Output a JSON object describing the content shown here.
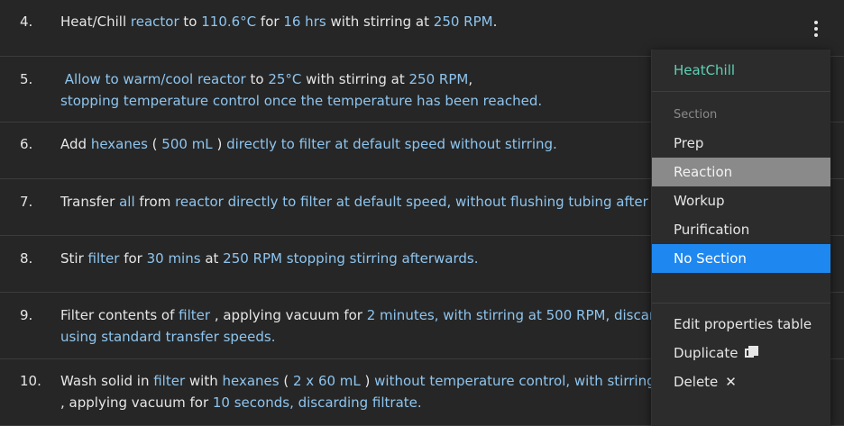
{
  "steps": [
    {
      "num": "4.",
      "lines": [
        [
          [
            "Heat/Chill ",
            "p"
          ],
          [
            "reactor",
            "h"
          ],
          [
            " to ",
            "p"
          ],
          [
            "110.6°C",
            "h"
          ],
          [
            " for ",
            "p"
          ],
          [
            "16 hrs",
            "h"
          ],
          [
            " with stirring at ",
            "p"
          ],
          [
            "250 RPM",
            "h"
          ],
          [
            ".",
            "p"
          ]
        ]
      ]
    },
    {
      "num": "5.",
      "lines": [
        [
          [
            " Allow to warm/cool ",
            "h"
          ],
          [
            "reactor",
            "h"
          ],
          [
            " to ",
            "p"
          ],
          [
            "25°C",
            "h"
          ],
          [
            " with stirring at ",
            "p"
          ],
          [
            "250 RPM",
            "h"
          ],
          [
            ",",
            "p"
          ]
        ],
        [
          [
            "stopping temperature control once the temperature has been reached.",
            "h"
          ]
        ]
      ]
    },
    {
      "num": "6.",
      "lines": [
        [
          [
            "Add ",
            "p"
          ],
          [
            "hexanes",
            "h"
          ],
          [
            " ( ",
            "p"
          ],
          [
            "500 mL",
            "h"
          ],
          [
            " ) ",
            "p"
          ],
          [
            "directly to ",
            "h"
          ],
          [
            "filter",
            "h"
          ],
          [
            " at default speed without stirring.",
            "h"
          ]
        ]
      ]
    },
    {
      "num": "7.",
      "lines": [
        [
          [
            "Transfer ",
            "p"
          ],
          [
            "all",
            "h"
          ],
          [
            " from ",
            "p"
          ],
          [
            "reactor",
            "h"
          ],
          [
            " directly to ",
            "h"
          ],
          [
            "filter",
            "h"
          ],
          [
            " at default speed, without flushing tubing after th",
            "h"
          ]
        ]
      ]
    },
    {
      "num": "8.",
      "lines": [
        [
          [
            "Stir ",
            "p"
          ],
          [
            "filter",
            "h"
          ],
          [
            " for ",
            "p"
          ],
          [
            "30 mins",
            "h"
          ],
          [
            " at ",
            "p"
          ],
          [
            "250 RPM",
            "h"
          ],
          [
            " stopping stirring afterwards.",
            "h"
          ]
        ]
      ]
    },
    {
      "num": "9.",
      "lines": [
        [
          [
            "Filter contents of ",
            "p"
          ],
          [
            "filter",
            "h"
          ],
          [
            " , applying vacuum for ",
            "p"
          ],
          [
            "2 minutes",
            "h"
          ],
          [
            ", with stirring at ",
            "h"
          ],
          [
            "500 RPM",
            "h"
          ],
          [
            ", discardin",
            "h"
          ]
        ],
        [
          [
            "using standard transfer speeds.",
            "h"
          ]
        ]
      ]
    },
    {
      "num": "10.",
      "lines": [
        [
          [
            "Wash solid in ",
            "p"
          ],
          [
            "filter",
            "h"
          ],
          [
            " with ",
            "p"
          ],
          [
            "hexanes",
            "h"
          ],
          [
            " ( ",
            "p"
          ],
          [
            "2 x 60 mL",
            "h"
          ],
          [
            " ) ",
            "p"
          ],
          [
            "without temperature control, with stirring at",
            "h"
          ]
        ],
        [
          [
            ", applying vacuum for ",
            "p"
          ],
          [
            "10 seconds",
            "h"
          ],
          [
            ", discarding filtrate.",
            "h"
          ]
        ]
      ]
    }
  ],
  "menu": {
    "title": "HeatChill",
    "section_header": "Section",
    "sections": [
      "Prep",
      "Reaction",
      "Workup",
      "Purification",
      "No Section"
    ],
    "hovered_section": "Reaction",
    "selected_section": "No Section",
    "actions": {
      "edit": "Edit properties table",
      "duplicate": "Duplicate",
      "delete": "Delete"
    },
    "icons": {
      "duplicate": "copy-icon",
      "delete": "close-icon"
    }
  },
  "colors": {
    "background": "#262626",
    "highlight_text": "#8ec5ef",
    "title_text": "#5fd0b4",
    "selected_bg": "#1e88f0",
    "hover_bg": "#8a8a8a"
  }
}
